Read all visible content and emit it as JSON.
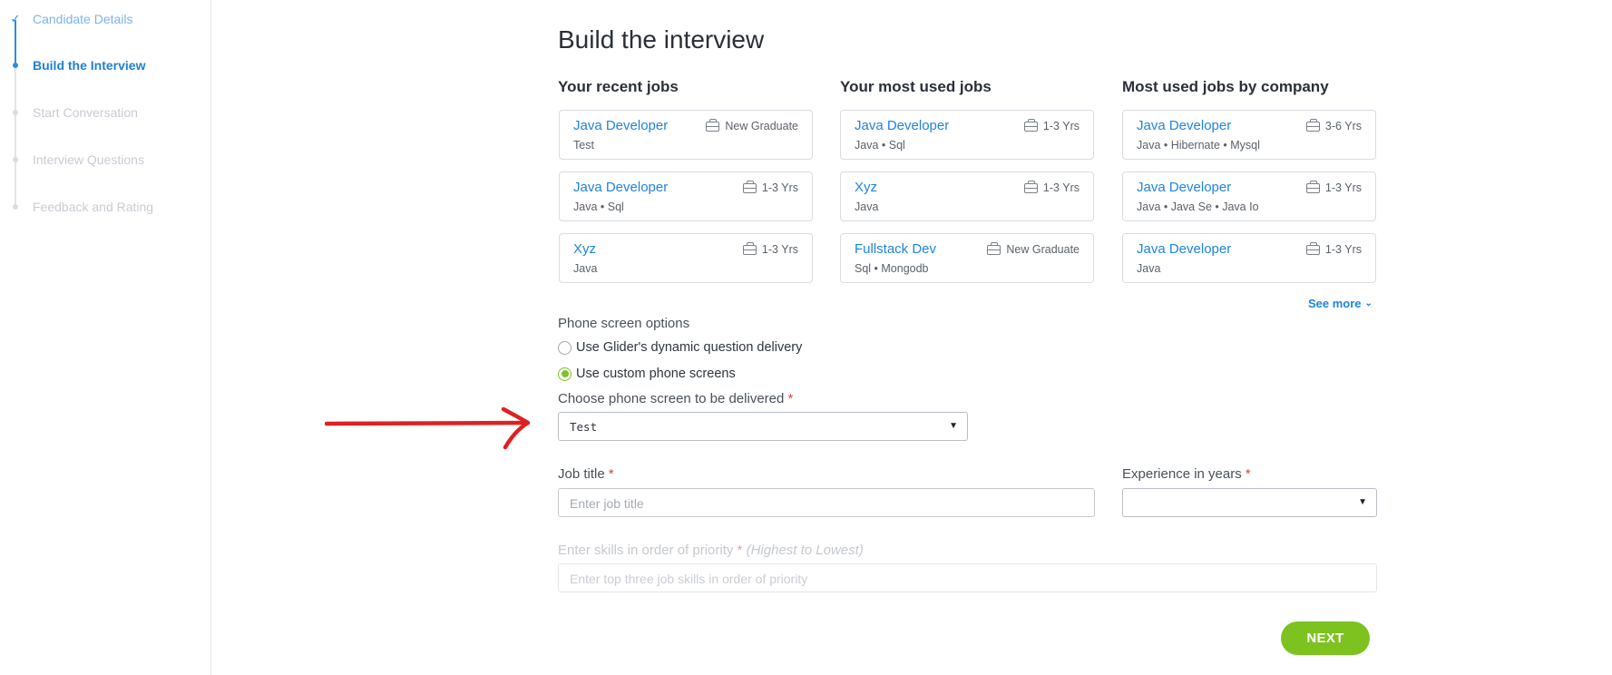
{
  "sidebar": {
    "steps": [
      {
        "label": "Candidate Details",
        "state": "done"
      },
      {
        "label": "Build the Interview",
        "state": "active"
      },
      {
        "label": "Start Conversation",
        "state": "pending"
      },
      {
        "label": "Interview Questions",
        "state": "pending"
      },
      {
        "label": "Feedback and Rating",
        "state": "pending"
      }
    ]
  },
  "main": {
    "title": "Build the interview",
    "columns": [
      {
        "title": "Your recent jobs",
        "jobs": [
          {
            "name": "Java Developer",
            "exp": "New Graduate",
            "skills": "Test"
          },
          {
            "name": "Java Developer",
            "exp": "1-3 Yrs",
            "skills": "Java • Sql"
          },
          {
            "name": "Xyz",
            "exp": "1-3 Yrs",
            "skills": "Java"
          }
        ]
      },
      {
        "title": "Your most used jobs",
        "jobs": [
          {
            "name": "Java Developer",
            "exp": "1-3 Yrs",
            "skills": "Java • Sql"
          },
          {
            "name": "Xyz",
            "exp": "1-3 Yrs",
            "skills": "Java"
          },
          {
            "name": "Fullstack Dev",
            "exp": "New Graduate",
            "skills": "Sql • Mongodb"
          }
        ]
      },
      {
        "title": "Most used jobs by company",
        "jobs": [
          {
            "name": "Java Developer",
            "exp": "3-6 Yrs",
            "skills": "Java • Hibernate • Mysql"
          },
          {
            "name": "Java Developer",
            "exp": "1-3 Yrs",
            "skills": "Java • Java Se • Java Io"
          },
          {
            "name": "Java Developer",
            "exp": "1-3 Yrs",
            "skills": "Java"
          }
        ]
      }
    ],
    "see_more": "See more",
    "phone_screen": {
      "section_label": "Phone screen options",
      "option_dynamic": "Use Glider's dynamic question delivery",
      "option_custom": "Use custom phone screens",
      "choose_label": "Choose phone screen to be delivered",
      "required_mark": "*",
      "selected_value": "Test"
    },
    "job_title": {
      "label": "Job title",
      "required_mark": "*",
      "placeholder": "Enter job title"
    },
    "experience": {
      "label": "Experience in years",
      "required_mark": "*",
      "selected_value": ""
    },
    "skills": {
      "label": "Enter skills in order of priority",
      "required_mark": "*",
      "hint": "(Highest to Lowest)",
      "placeholder": "Enter top three job skills in order of priority"
    },
    "next_label": "NEXT"
  },
  "colors": {
    "accent_blue": "#1f84dd",
    "accent_green": "#7dc21f",
    "annotation_red": "#e02020"
  }
}
